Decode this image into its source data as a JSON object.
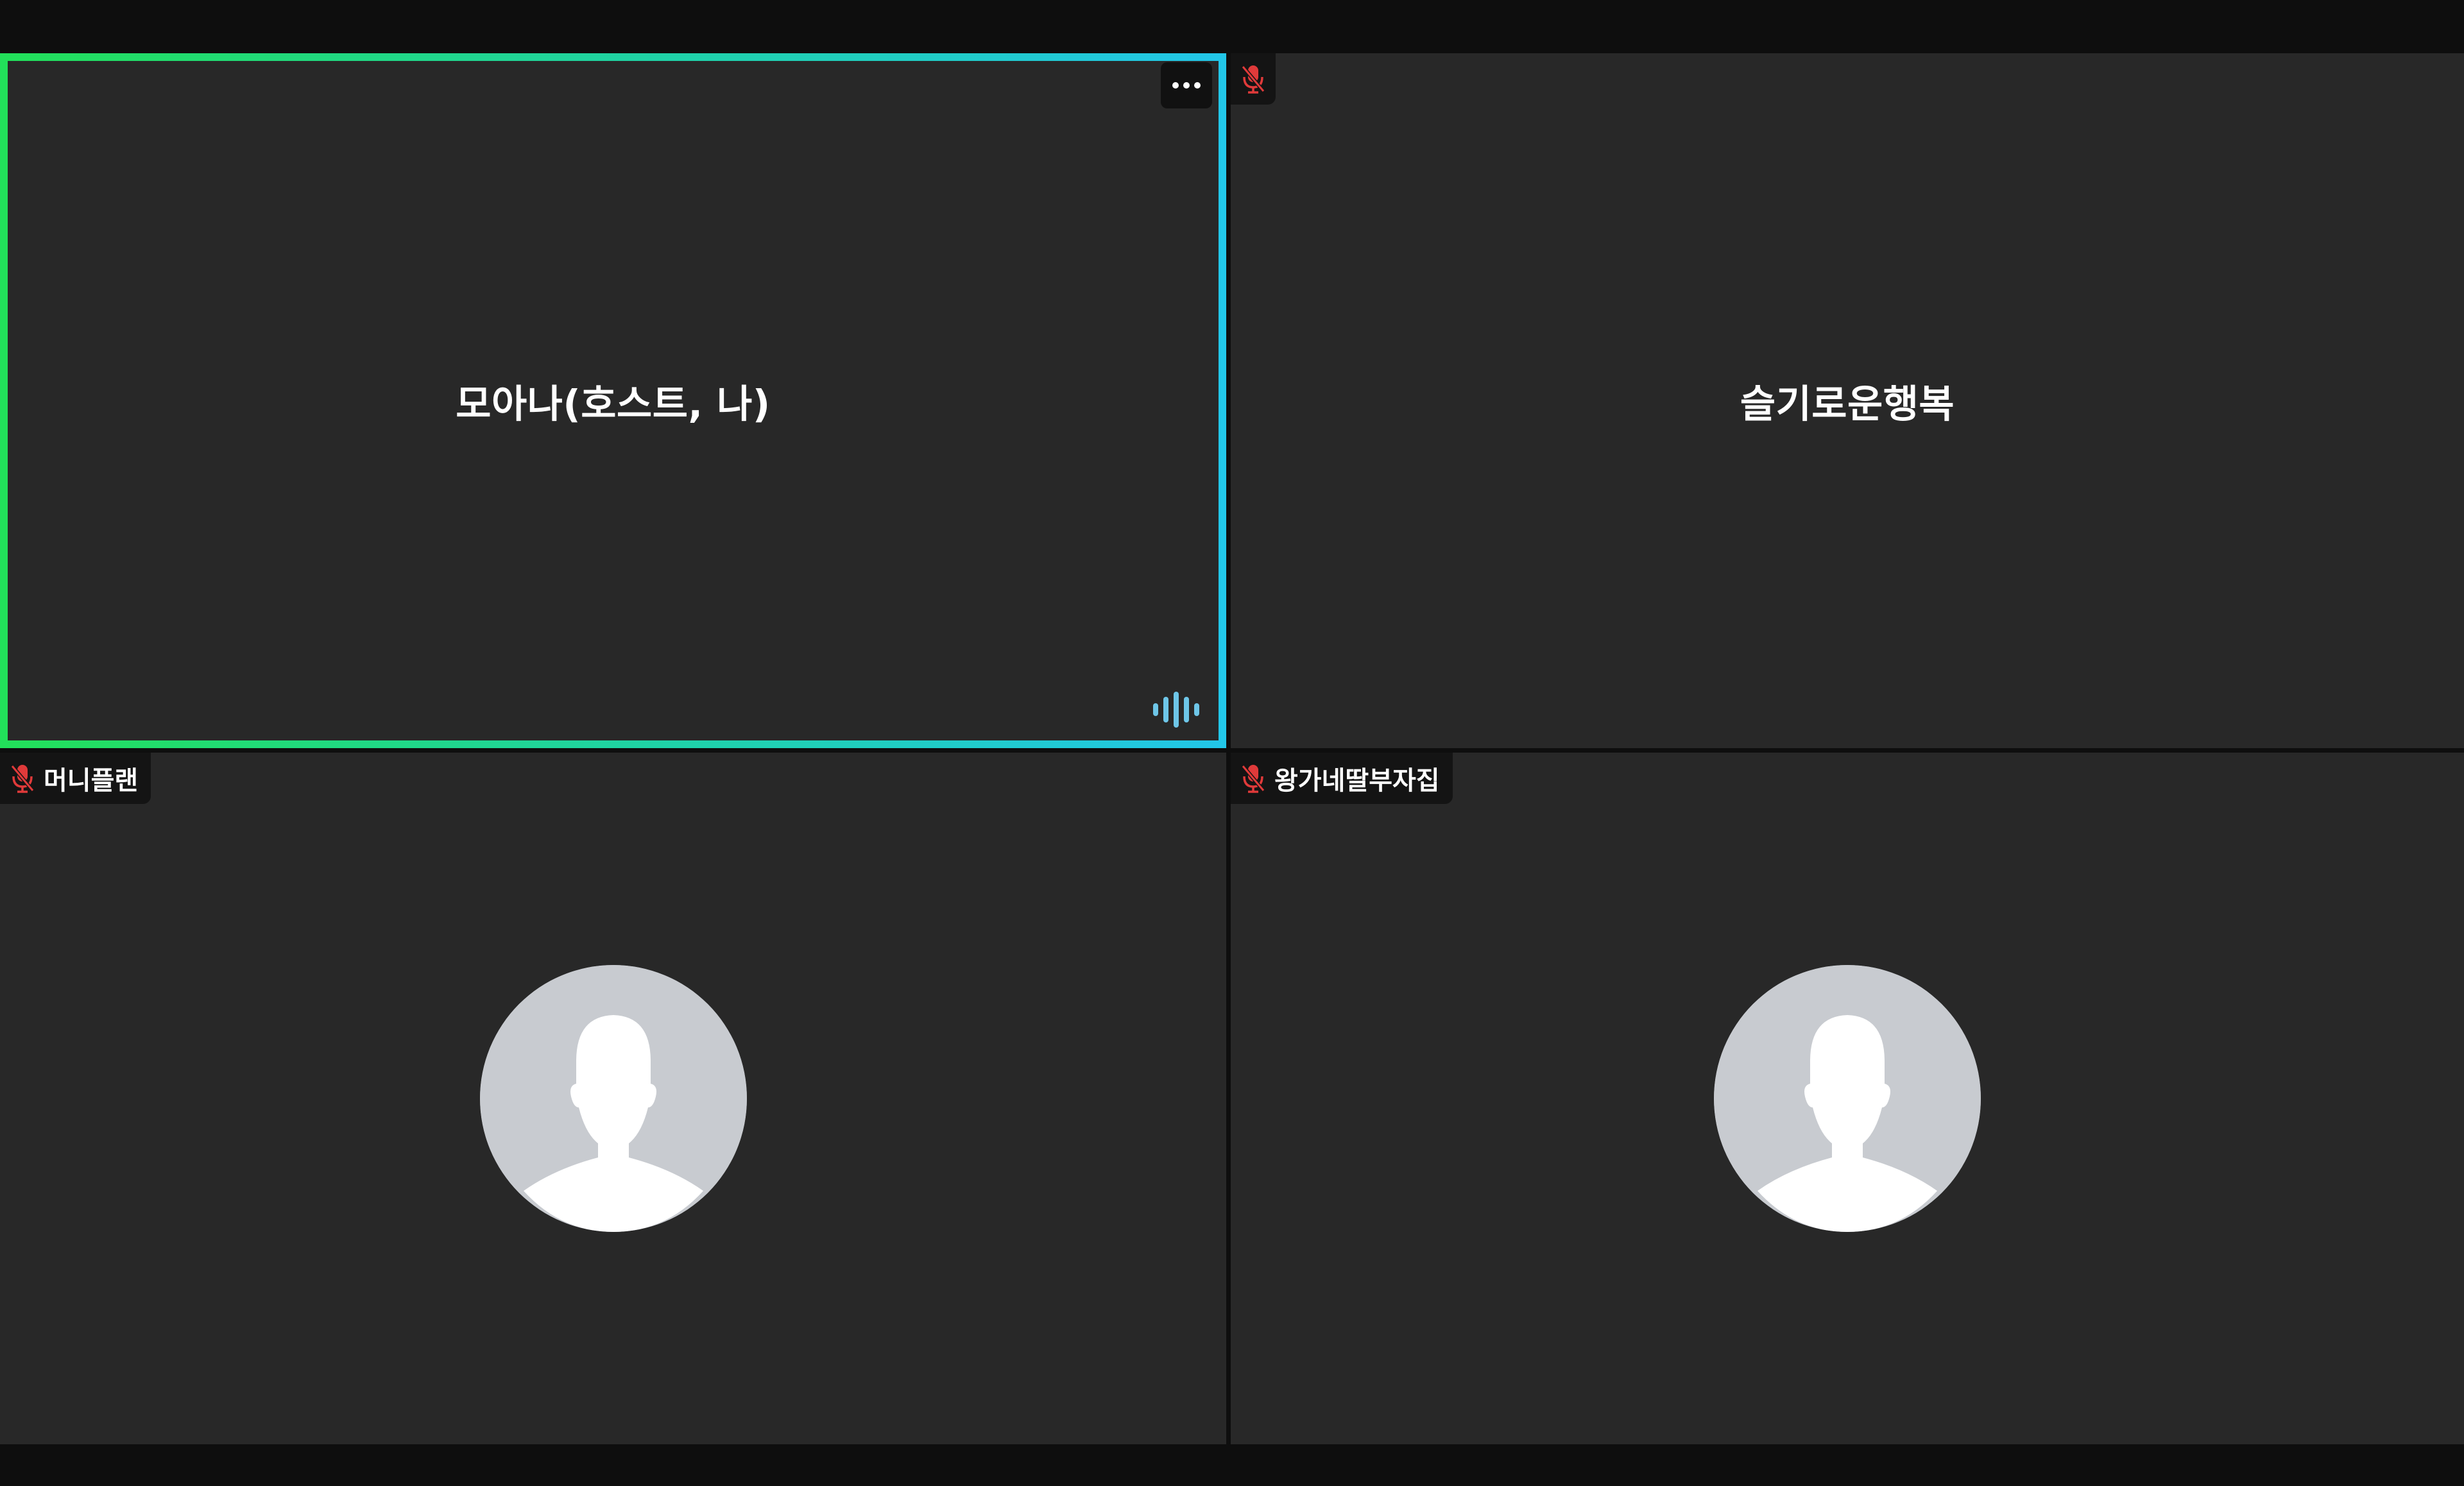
{
  "participants": [
    {
      "name": "모아나(호스트, 나)",
      "video": "off",
      "muted": false,
      "speaking": true,
      "active_speaker": true
    },
    {
      "name": "슬기로운행복",
      "video": "off",
      "muted": true,
      "speaking": false
    },
    {
      "name": "머니플랜",
      "video": "off",
      "muted": true,
      "avatar": "default-person-avatar"
    },
    {
      "name": "왕가네딸부자집",
      "video": "off",
      "muted": true,
      "avatar": "default-person-avatar"
    }
  ],
  "icons": {
    "more": "more-options-icon",
    "speaking": "audio-level-icon",
    "muted": "mic-off-icon",
    "avatar": "default-person-avatar"
  },
  "colors": {
    "background": "#0e0e0e",
    "tile": "#282828",
    "active_border_start": "#22e05a",
    "active_border_end": "#22c6e8",
    "muted_icon": "#e03a3a",
    "speaking_icon": "#6ec6e8",
    "avatar_bg": "#c8cbd0"
  }
}
